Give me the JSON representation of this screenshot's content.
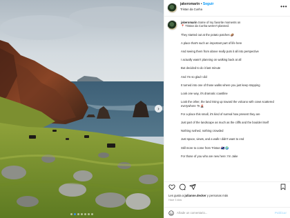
{
  "post": {
    "username": "jakeromarin",
    "separator": "•",
    "follow_label": "Seguir",
    "location": "Tristan da Cunha",
    "more_icon": "more-horizontal-icon"
  },
  "caption": {
    "username": "jakeromarin",
    "line0_rest": "Some of my favorite moments on",
    "line1": "📍 Tristan da Cunha weren't planned.",
    "paragraphs": [
      "They started out at the potato patches 🥔",
      "A place that's such an important part of life here",
      "And seeing them from above really puts it all into perspective",
      "I actually wasn't planning on walking back at all",
      "But decided to do it last minute",
      "And I'm so glad I did",
      "It turned into one of those walks where you just keep stopping",
      "Look one way, it's dramatic coastline",
      "Look the other, the land rising up toward the volcano with cows scattered everywhere 🐄🌋",
      "For a place this small, it's kind of surreal how present they are",
      "Just part of the landscape as much as the cliffs and the boulder itself",
      "Nothing rushed, nothing crowded",
      "Just space, views, and a walk I didn't want to end",
      "Still more to come from Tristan 🇹🇦 🌍",
      "For those of you who are new here: I'm Jake"
    ]
  },
  "actions": {
    "like_icon": "heart-icon",
    "comment_icon": "comment-icon",
    "share_icon": "share-icon",
    "save_icon": "bookmark-icon"
  },
  "likes": {
    "prefix": "Les gusta a ",
    "user": "julianne.decker",
    "suffix": " y personas más"
  },
  "timestamp": "Hace 3 días",
  "comment": {
    "emoji_icon": "emoji-icon",
    "placeholder": "Añade un comentario...",
    "publish_label": "Publicar"
  },
  "carousel": {
    "slide_count": 7,
    "active_index": 1,
    "next_icon": "chevron-right-icon"
  }
}
